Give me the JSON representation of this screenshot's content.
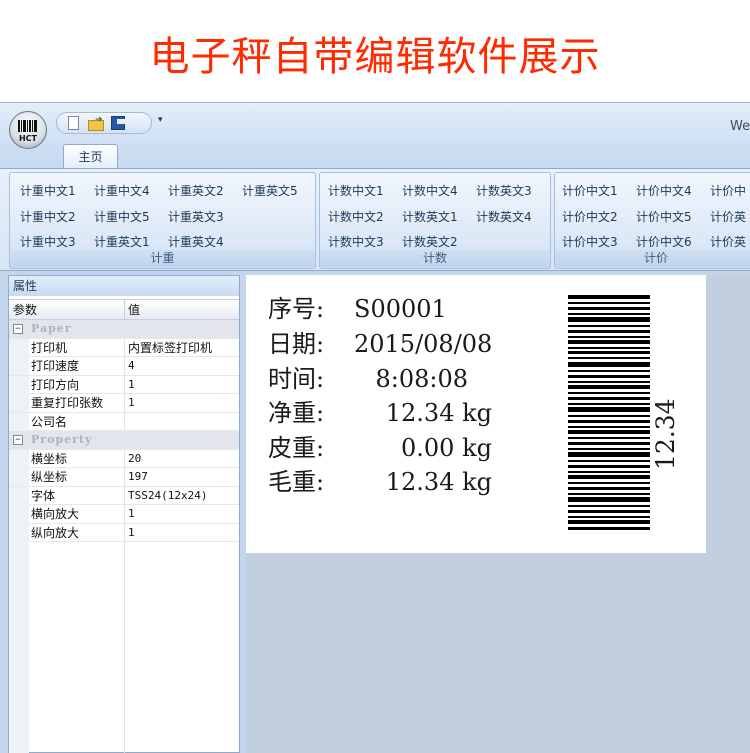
{
  "banner": {
    "title": "电子秤自带编辑软件展示"
  },
  "app": {
    "logo_text": "HCT",
    "window_title": "We",
    "tabs": [
      {
        "label": "主页"
      }
    ],
    "ribbon": {
      "groups": [
        {
          "name": "计重",
          "buttons": [
            "计重中文1",
            "计重中文4",
            "计重英文2",
            "计重英文5",
            "计重中文2",
            "计重中文5",
            "计重英文3",
            "计重中文3",
            "计重英文1",
            "计重英文4"
          ]
        },
        {
          "name": "计数",
          "buttons": [
            "计数中文1",
            "计数中文4",
            "计数英文3",
            "计数中文2",
            "计数英文1",
            "计数英文4",
            "计数中文3",
            "计数英文2"
          ]
        },
        {
          "name": "计价",
          "buttons": [
            "计价中文1",
            "计价中文4",
            "计价中",
            "计价中文2",
            "计价中文5",
            "计价英",
            "计价中文3",
            "计价中文6",
            "计价英"
          ]
        }
      ]
    },
    "properties": {
      "panel_title": "属性",
      "col_param": "参数",
      "col_value": "值",
      "categories": [
        {
          "name": "Paper",
          "rows": [
            {
              "key": "打印机",
              "value": "内置标签打印机"
            },
            {
              "key": "打印速度",
              "value": "4"
            },
            {
              "key": "打印方向",
              "value": "1"
            },
            {
              "key": "重复打印张数",
              "value": "1"
            },
            {
              "key": "公司名",
              "value": ""
            }
          ]
        },
        {
          "name": "Property",
          "rows": [
            {
              "key": "横坐标",
              "value": "20"
            },
            {
              "key": "纵坐标",
              "value": "197"
            },
            {
              "key": "字体",
              "value": "TSS24(12x24)"
            },
            {
              "key": "横向放大",
              "value": "1"
            },
            {
              "key": "纵向放大",
              "value": "1"
            }
          ]
        }
      ]
    },
    "label": {
      "lines": [
        {
          "key": "序号:",
          "value": "S00001"
        },
        {
          "key": "日期:",
          "value": "2015/08/08"
        },
        {
          "key": "时间:",
          "value": "8:08:08"
        },
        {
          "key": "净重:",
          "value": "12.34 kg"
        },
        {
          "key": "皮重:",
          "value": "0.00 kg"
        },
        {
          "key": "毛重:",
          "value": "12.34 kg"
        }
      ],
      "barcode_text": "12.34"
    },
    "colors": {
      "banner_title": "#ff2a00",
      "ribbon_text": "#1e395b",
      "workspace": "#c2cfdf"
    },
    "icons": [
      "app-orb-barcode-icon",
      "new-file-icon",
      "open-folder-icon",
      "save-disk-icon",
      "quick-access-dropdown-icon",
      "collapse-minus-icon"
    ]
  }
}
